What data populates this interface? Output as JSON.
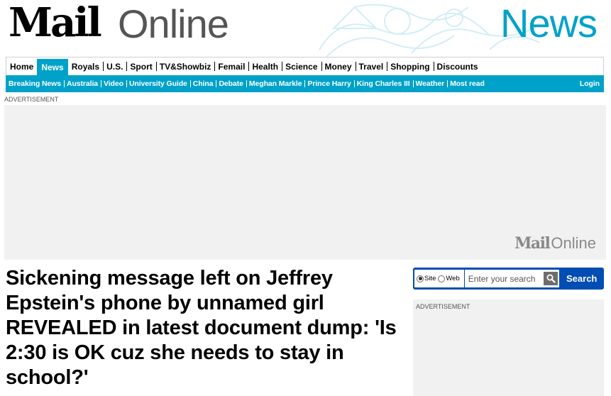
{
  "masthead": {
    "logo_mail": "Mail",
    "logo_online": "Online",
    "section_title": "News"
  },
  "primary_nav": [
    {
      "label": "Home",
      "active": false
    },
    {
      "label": "News",
      "active": true
    },
    {
      "label": "Royals",
      "active": false
    },
    {
      "label": "U.S.",
      "active": false
    },
    {
      "label": "Sport",
      "active": false
    },
    {
      "label": "TV&Showbiz",
      "active": false
    },
    {
      "label": "Femail",
      "active": false
    },
    {
      "label": "Health",
      "active": false
    },
    {
      "label": "Science",
      "active": false
    },
    {
      "label": "Money",
      "active": false
    },
    {
      "label": "Travel",
      "active": false
    },
    {
      "label": "Shopping",
      "active": false
    },
    {
      "label": "Discounts",
      "active": false
    }
  ],
  "secondary_nav": [
    "Breaking News",
    "Australia",
    "Video",
    "University Guide",
    "China",
    "Debate",
    "Meghan Markle",
    "Prince Harry",
    "King Charles III",
    "Weather",
    "Most read"
  ],
  "login_label": "Login",
  "ad_label_top": "ADVERTISEMENT",
  "ad_banner_logo": {
    "mail": "Mail",
    "online": "Online"
  },
  "headline": "Sickening message left on Jeffrey Epstein's phone by unnamed girl REVEALED in latest document dump: 'Is 2:30 is OK cuz she needs to stay in school?'",
  "search": {
    "option_site": "Site",
    "option_web": "Web",
    "selected": "Site",
    "placeholder": "Enter your search",
    "button_label": "Search"
  },
  "ad_label_right": "ADVERTISEMENT",
  "colors": {
    "accent": "#00a2c9",
    "search_bg": "#004db3"
  }
}
